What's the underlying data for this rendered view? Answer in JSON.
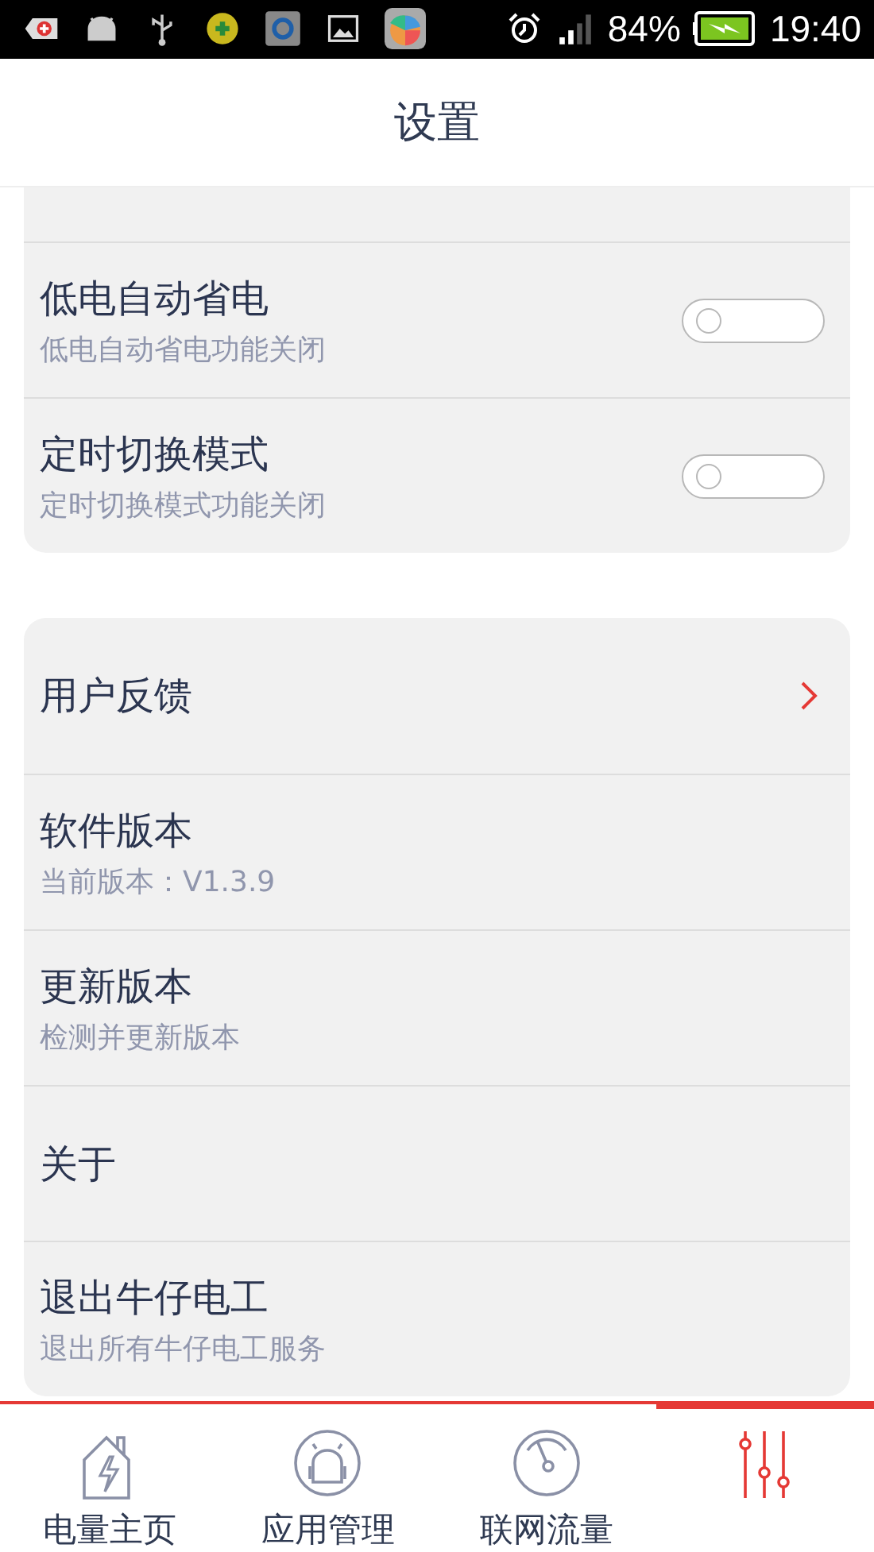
{
  "status_bar": {
    "battery": "84%",
    "time": "19:40"
  },
  "header": {
    "title": "设置"
  },
  "sections": [
    {
      "rows": [
        {
          "kind": "cut"
        },
        {
          "kind": "toggle",
          "title": "低电自动省电",
          "subtitle": "低电自动省电功能关闭",
          "on": false
        },
        {
          "kind": "toggle",
          "title": "定时切换模式",
          "subtitle": "定时切换模式功能关闭",
          "on": false
        }
      ]
    },
    {
      "rows": [
        {
          "kind": "link",
          "title": "用户反馈"
        },
        {
          "kind": "plain",
          "title": "软件版本",
          "subtitle": "当前版本：V1.3.9"
        },
        {
          "kind": "plain",
          "title": "更新版本",
          "subtitle": "检测并更新版本"
        },
        {
          "kind": "plain",
          "title": "关于"
        },
        {
          "kind": "plain",
          "title": "退出牛仔电工",
          "subtitle": "退出所有牛仔电工服务"
        }
      ]
    }
  ],
  "bottom_nav": [
    {
      "label": "电量主页",
      "selected": false
    },
    {
      "label": "应用管理",
      "selected": false
    },
    {
      "label": "联网流量",
      "selected": false
    },
    {
      "selected": true
    }
  ]
}
